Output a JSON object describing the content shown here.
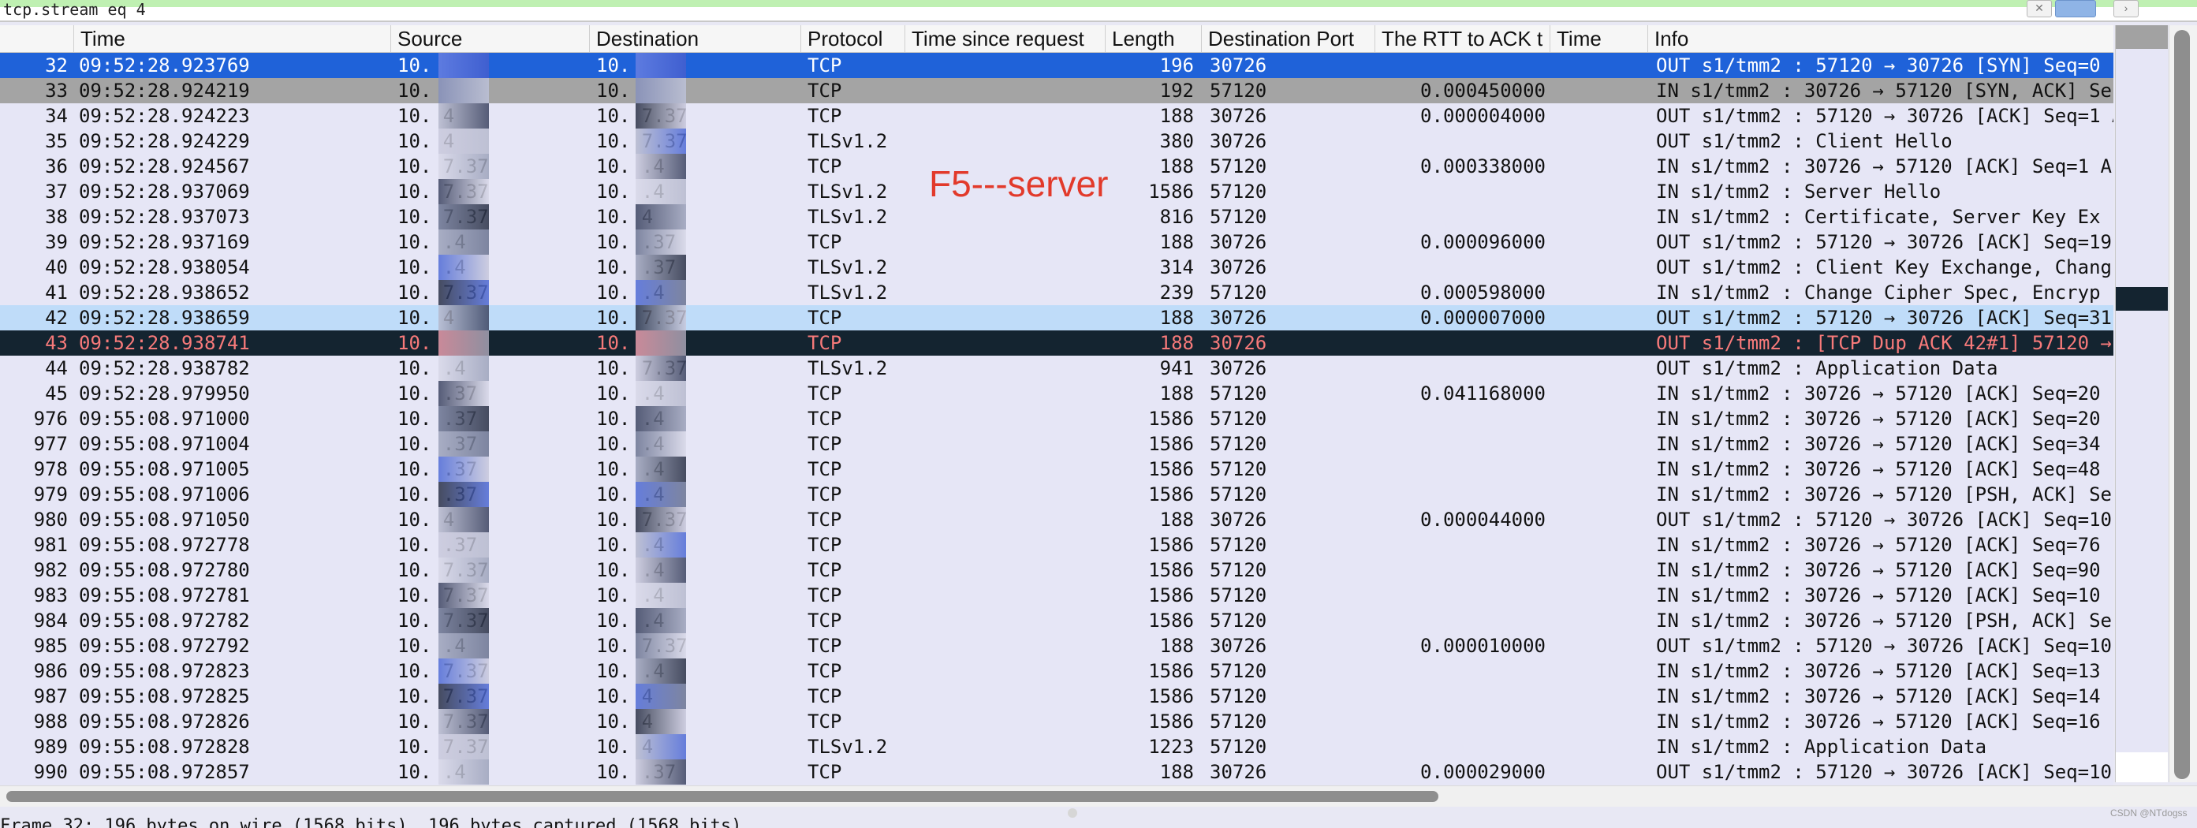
{
  "filter": {
    "value": "tcp.stream eq 4"
  },
  "columns": [
    {
      "key": "no",
      "label": ""
    },
    {
      "key": "time",
      "label": "Time"
    },
    {
      "key": "src",
      "label": "Source"
    },
    {
      "key": "dst",
      "label": "Destination"
    },
    {
      "key": "proto",
      "label": "Protocol"
    },
    {
      "key": "tsr",
      "label": "Time since request"
    },
    {
      "key": "len",
      "label": "Length"
    },
    {
      "key": "port",
      "label": "Destination Port"
    },
    {
      "key": "rtt",
      "label": "The RTT to ACK t"
    },
    {
      "key": "time2",
      "label": "Time"
    },
    {
      "key": "info",
      "label": "Info"
    }
  ],
  "annotation": "F5---server",
  "rows": [
    {
      "no": "32",
      "time": "09:52:28.923769",
      "src": "10.  4",
      "dst": "10.  7.37",
      "proto": "TCP",
      "len": "196",
      "port": "30726",
      "rtt": "",
      "info": "OUT s1/tmm2 : 57120 → 30726 [SYN] Seq=0",
      "style": "selected"
    },
    {
      "no": "33",
      "time": "09:52:28.924219",
      "src": "10.  .37",
      "dst": "10.  .4",
      "proto": "TCP",
      "len": "192",
      "port": "57120",
      "rtt": "0.000450000",
      "info": "IN  s1/tmm2 : 30726 → 57120 [SYN, ACK] Se",
      "style": "related"
    },
    {
      "no": "34",
      "time": "09:52:28.924223",
      "src": "10.  4",
      "dst": "10.  7.37",
      "proto": "TCP",
      "len": "188",
      "port": "30726",
      "rtt": "0.000004000",
      "info": "OUT s1/tmm2 : 57120 → 30726 [ACK] Seq=1 A",
      "style": ""
    },
    {
      "no": "35",
      "time": "09:52:28.924229",
      "src": "10.  4",
      "dst": "10.  7.37",
      "proto": "TLSv1.2",
      "len": "380",
      "port": "30726",
      "rtt": "",
      "info": "OUT s1/tmm2 : Client Hello",
      "style": ""
    },
    {
      "no": "36",
      "time": "09:52:28.924567",
      "src": "10.  7.37",
      "dst": "10.  .4",
      "proto": "TCP",
      "len": "188",
      "port": "57120",
      "rtt": "0.000338000",
      "info": "IN  s1/tmm2 : 30726 → 57120 [ACK] Seq=1 A",
      "style": ""
    },
    {
      "no": "37",
      "time": "09:52:28.937069",
      "src": "10.  7.37",
      "dst": "10.  .4",
      "proto": "TLSv1.2",
      "len": "1586",
      "port": "57120",
      "rtt": "",
      "info": "IN  s1/tmm2 : Server Hello",
      "style": ""
    },
    {
      "no": "38",
      "time": "09:52:28.937073",
      "src": "10.  7.37",
      "dst": "10.  4",
      "proto": "TLSv1.2",
      "len": "816",
      "port": "57120",
      "rtt": "",
      "info": "IN  s1/tmm2 : Certificate, Server Key Ex",
      "style": ""
    },
    {
      "no": "39",
      "time": "09:52:28.937169",
      "src": "10.  .4",
      "dst": "10.  .37",
      "proto": "TCP",
      "len": "188",
      "port": "30726",
      "rtt": "0.000096000",
      "info": "OUT s1/tmm2 : 57120 → 30726 [ACK] Seq=19",
      "style": ""
    },
    {
      "no": "40",
      "time": "09:52:28.938054",
      "src": "10.  .4",
      "dst": "10.  .37",
      "proto": "TLSv1.2",
      "len": "314",
      "port": "30726",
      "rtt": "",
      "info": "OUT s1/tmm2 : Client Key Exchange, Chang",
      "style": ""
    },
    {
      "no": "41",
      "time": "09:52:28.938652",
      "src": "10.  7.37",
      "dst": "10.  .4",
      "proto": "TLSv1.2",
      "len": "239",
      "port": "57120",
      "rtt": "0.000598000",
      "info": "IN  s1/tmm2 : Change Cipher Spec, Encryp",
      "style": ""
    },
    {
      "no": "42",
      "time": "09:52:28.938659",
      "src": "10.  4",
      "dst": "10.  7.37",
      "proto": "TCP",
      "len": "188",
      "port": "30726",
      "rtt": "0.000007000",
      "info": "OUT s1/tmm2 : 57120 → 30726 [ACK] Seq=31",
      "style": "marked"
    },
    {
      "no": "43",
      "time": "09:52:28.938741",
      "src": "10.  4",
      "dst": "10.  7.37",
      "proto": "TCP",
      "len": "188",
      "port": "30726",
      "rtt": "",
      "info": "OUT s1/tmm2 : [TCP Dup ACK 42#1] 57120 →",
      "style": "dup"
    },
    {
      "no": "44",
      "time": "09:52:28.938782",
      "src": "10.  .4",
      "dst": "10.  7.37",
      "proto": "TLSv1.2",
      "len": "941",
      "port": "30726",
      "rtt": "",
      "info": "OUT s1/tmm2 : Application Data",
      "style": ""
    },
    {
      "no": "45",
      "time": "09:52:28.979950",
      "src": "10.  .37",
      "dst": "10.  .4",
      "proto": "TCP",
      "len": "188",
      "port": "57120",
      "rtt": "0.041168000",
      "info": "IN  s1/tmm2 : 30726 → 57120 [ACK] Seq=20",
      "style": ""
    },
    {
      "no": "976",
      "time": "09:55:08.971000",
      "src": "10.  .37",
      "dst": "10.  .4",
      "proto": "TCP",
      "len": "1586",
      "port": "57120",
      "rtt": "",
      "info": "IN  s1/tmm2 : 30726 → 57120 [ACK] Seq=20",
      "style": ""
    },
    {
      "no": "977",
      "time": "09:55:08.971004",
      "src": "10.  .37",
      "dst": "10.  .4",
      "proto": "TCP",
      "len": "1586",
      "port": "57120",
      "rtt": "",
      "info": "IN  s1/tmm2 : 30726 → 57120 [ACK] Seq=34",
      "style": ""
    },
    {
      "no": "978",
      "time": "09:55:08.971005",
      "src": "10.  .37",
      "dst": "10.  .4",
      "proto": "TCP",
      "len": "1586",
      "port": "57120",
      "rtt": "",
      "info": "IN  s1/tmm2 : 30726 → 57120 [ACK] Seq=48",
      "style": ""
    },
    {
      "no": "979",
      "time": "09:55:08.971006",
      "src": "10.  .37",
      "dst": "10.  .4",
      "proto": "TCP",
      "len": "1586",
      "port": "57120",
      "rtt": "",
      "info": "IN  s1/tmm2 : 30726 → 57120 [PSH, ACK] Se",
      "style": ""
    },
    {
      "no": "980",
      "time": "09:55:08.971050",
      "src": "10.  4",
      "dst": "10.  7.37",
      "proto": "TCP",
      "len": "188",
      "port": "30726",
      "rtt": "0.000044000",
      "info": "OUT s1/tmm2 : 57120 → 30726 [ACK] Seq=10",
      "style": ""
    },
    {
      "no": "981",
      "time": "09:55:08.972778",
      "src": "10.  .37",
      "dst": "10.  .4",
      "proto": "TCP",
      "len": "1586",
      "port": "57120",
      "rtt": "",
      "info": "IN  s1/tmm2 : 30726 → 57120 [ACK] Seq=76",
      "style": ""
    },
    {
      "no": "982",
      "time": "09:55:08.972780",
      "src": "10.  7.37",
      "dst": "10.  .4",
      "proto": "TCP",
      "len": "1586",
      "port": "57120",
      "rtt": "",
      "info": "IN  s1/tmm2 : 30726 → 57120 [ACK] Seq=90",
      "style": ""
    },
    {
      "no": "983",
      "time": "09:55:08.972781",
      "src": "10.  7.37",
      "dst": "10.  .4",
      "proto": "TCP",
      "len": "1586",
      "port": "57120",
      "rtt": "",
      "info": "IN  s1/tmm2 : 30726 → 57120 [ACK] Seq=10",
      "style": ""
    },
    {
      "no": "984",
      "time": "09:55:08.972782",
      "src": "10.  7.37",
      "dst": "10.  .4",
      "proto": "TCP",
      "len": "1586",
      "port": "57120",
      "rtt": "",
      "info": "IN  s1/tmm2 : 30726 → 57120 [PSH, ACK] Se",
      "style": ""
    },
    {
      "no": "985",
      "time": "09:55:08.972792",
      "src": "10.  .4",
      "dst": "10.  7.37",
      "proto": "TCP",
      "len": "188",
      "port": "30726",
      "rtt": "0.000010000",
      "info": "OUT s1/tmm2 : 57120 → 30726 [ACK] Seq=10",
      "style": ""
    },
    {
      "no": "986",
      "time": "09:55:08.972823",
      "src": "10.  7.37",
      "dst": "10.  .4",
      "proto": "TCP",
      "len": "1586",
      "port": "57120",
      "rtt": "",
      "info": "IN  s1/tmm2 : 30726 → 57120 [ACK] Seq=13",
      "style": ""
    },
    {
      "no": "987",
      "time": "09:55:08.972825",
      "src": "10.  7.37",
      "dst": "10.  4",
      "proto": "TCP",
      "len": "1586",
      "port": "57120",
      "rtt": "",
      "info": "IN  s1/tmm2 : 30726 → 57120 [ACK] Seq=14",
      "style": ""
    },
    {
      "no": "988",
      "time": "09:55:08.972826",
      "src": "10.  7.37",
      "dst": "10.  4",
      "proto": "TCP",
      "len": "1586",
      "port": "57120",
      "rtt": "",
      "info": "IN  s1/tmm2 : 30726 → 57120 [ACK] Seq=16",
      "style": ""
    },
    {
      "no": "989",
      "time": "09:55:08.972828",
      "src": "10.  7.37",
      "dst": "10.  4",
      "proto": "TLSv1.2",
      "len": "1223",
      "port": "57120",
      "rtt": "",
      "info": "IN  s1/tmm2 : Application Data",
      "style": ""
    },
    {
      "no": "990",
      "time": "09:55:08.972857",
      "src": "10.  .4",
      "dst": "10.  .37",
      "proto": "TCP",
      "len": "188",
      "port": "30726",
      "rtt": "0.000029000",
      "info": "OUT s1/tmm2 : 57120 → 30726 [ACK] Seq=10",
      "style": ""
    }
  ],
  "status_text": "Frame 32: 196 bytes on wire (1568 bits), 196 bytes captured (1568 bits)",
  "watermark": "CSDN @NTdogss",
  "colors": {
    "selected": "#1f62d9",
    "related": "#a4a4a4",
    "marked": "#bfdcf9",
    "dup_bg": "#142430",
    "dup_fg": "#f77a7a",
    "default": "#e6e6f6",
    "annotation": "#e23a2b"
  }
}
